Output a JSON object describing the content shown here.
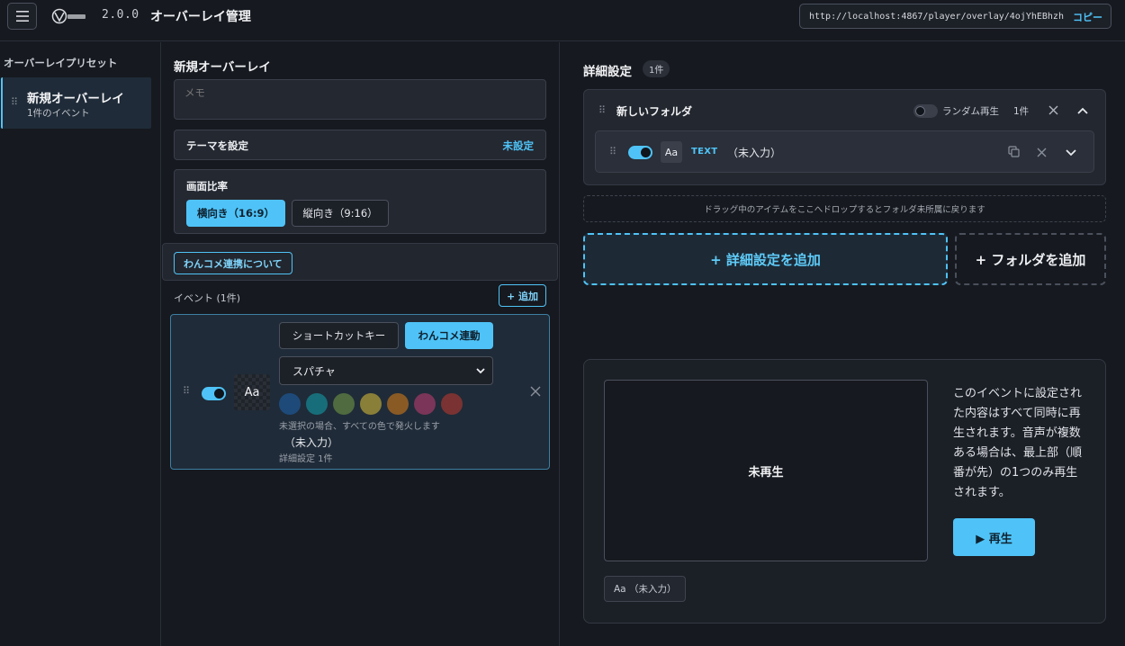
{
  "header": {
    "version": "2.0.0",
    "title": "オーバーレイ管理",
    "url": "http://localhost:4867/player/overlay/4ojYhEBhzh",
    "copy_label": "コピー"
  },
  "sidebar": {
    "title": "オーバーレイプリセット",
    "presets": [
      {
        "name": "新規オーバーレイ",
        "sub": "1件のイベント"
      }
    ]
  },
  "editor": {
    "title": "新規オーバーレイ",
    "memo_placeholder": "メモ",
    "theme_label": "テーマを設定",
    "theme_value": "未設定",
    "ratio_label": "画面比率",
    "ratio_options": [
      "横向き（16:9）",
      "縦向き（9:16）"
    ],
    "ratio_selected": "横向き（16:9）",
    "link_button": "わんコメ連携について",
    "events_label": "イベント (1件)",
    "add_event_label": "+ 追加",
    "event": {
      "tabs": [
        "ショートカットキー",
        "わんコメ連動"
      ],
      "active_tab": "わんコメ連動",
      "icon_text": "Aa",
      "select_value": "スパチャ",
      "colors": [
        "#1e4a7a",
        "#176e7a",
        "#4f6b3f",
        "#8a7f38",
        "#8a5a24",
        "#7a3558",
        "#7a3232"
      ],
      "color_note": "未選択の場合、すべての色で発火します",
      "value": "（未入力）",
      "detail_count": "詳細設定 1件"
    }
  },
  "details": {
    "title": "詳細設定",
    "count": "1件",
    "folder": {
      "name": "新しいフォルダ",
      "random_label": "ランダム再生",
      "count": "1件",
      "item": {
        "icon_text": "Aa",
        "type": "TEXT",
        "value": "（未入力）"
      }
    },
    "drop_hint": "ドラッグ中のアイテムをここへドロップするとフォルダ未所属に戻ります",
    "add_detail_label": "+ 詳細設定を追加",
    "add_folder_label": "+ フォルダを追加"
  },
  "preview": {
    "status": "未再生",
    "description": "このイベントに設定された内容はすべて同時に再生されます。音声が複数ある場合は、最上部（順番が先）の1つのみ再生されます。",
    "play_label": "▶ 再生",
    "tag": "Aa （未入力）"
  },
  "colors": {
    "accent": "#4fc3f7",
    "background": "#16191f",
    "card": "#1f2b38"
  }
}
